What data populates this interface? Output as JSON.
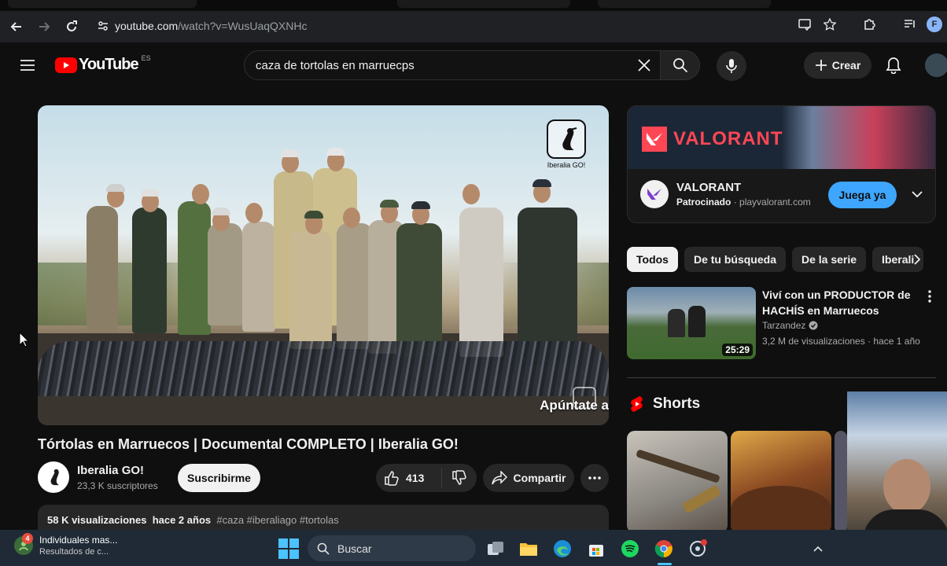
{
  "browser": {
    "url_host": "youtube.com",
    "url_path": "/watch?v=WusUaqQXNHc",
    "profile_initial": "F"
  },
  "header": {
    "logo_text": "YouTube",
    "country_code": "ES",
    "search_query": "caza de tortolas en marruecps",
    "create_label": "Crear"
  },
  "player": {
    "watermark_text": "Iberalia GO!",
    "overlay_text": "Apúntate a"
  },
  "video": {
    "title": "Tórtolas en Marruecos | Documental COMPLETO | Iberalia GO!",
    "channel_name": "Iberalia GO!",
    "subscribers": "23,3 K suscriptores",
    "subscribe_label": "Suscribirme",
    "likes": "413",
    "share_label": "Compartir",
    "views": "58 K visualizaciones",
    "age": "hace 2 años",
    "tags": "#caza #iberaliago #tortolas"
  },
  "ad": {
    "banner_text": "VALORANT",
    "name": "VALORANT",
    "sponsored_label": "Patrocinado",
    "domain": "playvalorant.com",
    "cta_label": "Juega ya"
  },
  "chips": [
    "Todos",
    "De tu búsqueda",
    "De la serie",
    "Iberali"
  ],
  "recommended": {
    "title": "Viví con un PRODUCTOR de HACHÍS en Marruecos",
    "channel": "Tarzandez",
    "views": "3,2 M de visualizaciones",
    "age": "hace 1 año",
    "duration": "25:29"
  },
  "shorts": {
    "label": "Shorts"
  },
  "taskbar": {
    "widget_title": "Individuales mas...",
    "widget_subtitle": "Resultados de c...",
    "widget_badge": "4",
    "search_label": "Buscar"
  },
  "colors": {
    "yt_red": "#ff0000",
    "accent_blue": "#3ea6ff",
    "valorant_red": "#ff4655"
  }
}
